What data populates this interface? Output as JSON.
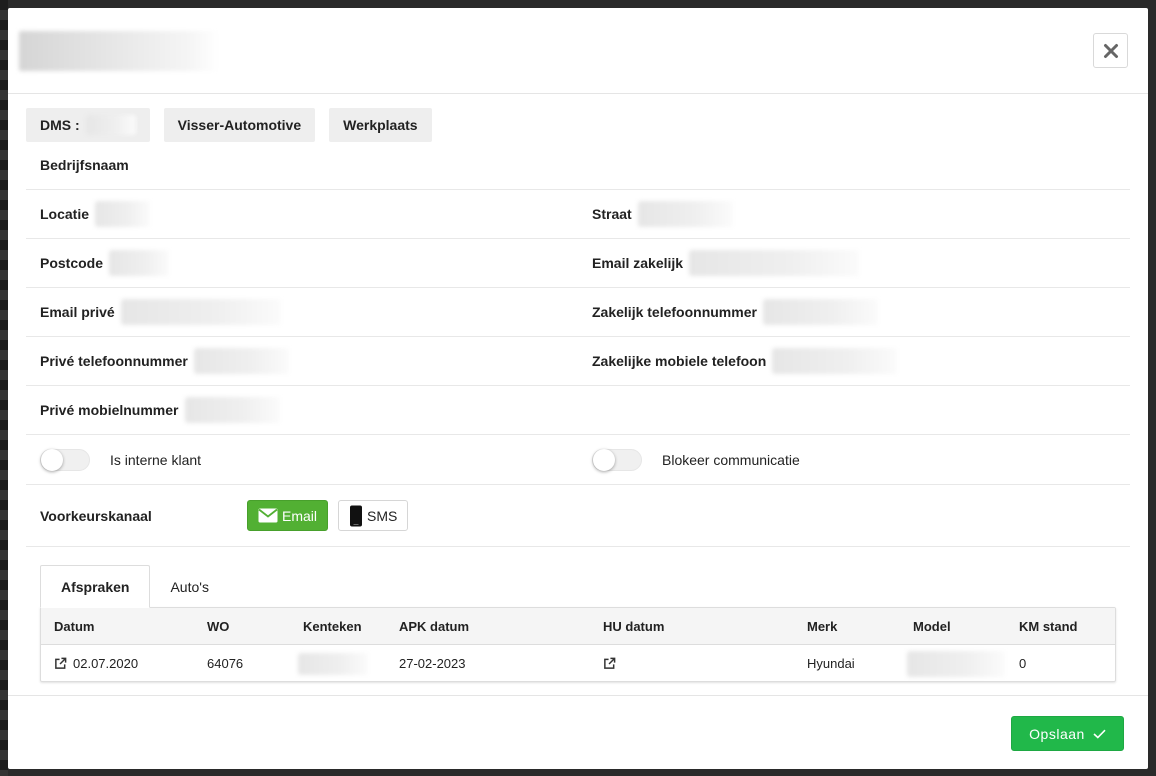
{
  "tags": {
    "dms_label": "DMS :",
    "company": "Visser-Automotive",
    "department": "Werkplaats"
  },
  "fields": {
    "bedrijfsnaam": "Bedrijfsnaam",
    "locatie": "Locatie",
    "straat": "Straat",
    "postcode": "Postcode",
    "email_zakelijk": "Email zakelijk",
    "email_prive": "Email privé",
    "zakelijk_telefoon": "Zakelijk telefoonnummer",
    "prive_telefoon": "Privé telefoonnummer",
    "zakelijk_mobiel": "Zakelijke mobiele telefoon",
    "prive_mobiel": "Privé mobielnummer"
  },
  "toggles": {
    "interne_klant": {
      "label": "Is interne klant",
      "on": false
    },
    "blokkeer": {
      "label": "Blokeer communicatie",
      "on": false
    }
  },
  "preference": {
    "label": "Voorkeurskanaal",
    "email": "Email",
    "sms": "SMS",
    "selected": "Email"
  },
  "tabs": [
    "Afspraken",
    "Auto's"
  ],
  "table": {
    "headers": [
      "Datum",
      "WO",
      "Kenteken",
      "APK datum",
      "HU datum",
      "Merk",
      "Model",
      "KM stand"
    ],
    "rows": [
      {
        "datum": "02.07.2020",
        "wo": "64076",
        "apk": "27-02-2023",
        "merk": "Hyundai",
        "km": "0"
      }
    ]
  },
  "footer": {
    "save_label": "Opslaan"
  },
  "colors": {
    "primary_green": "#21b84a",
    "email_green": "#52b033"
  }
}
